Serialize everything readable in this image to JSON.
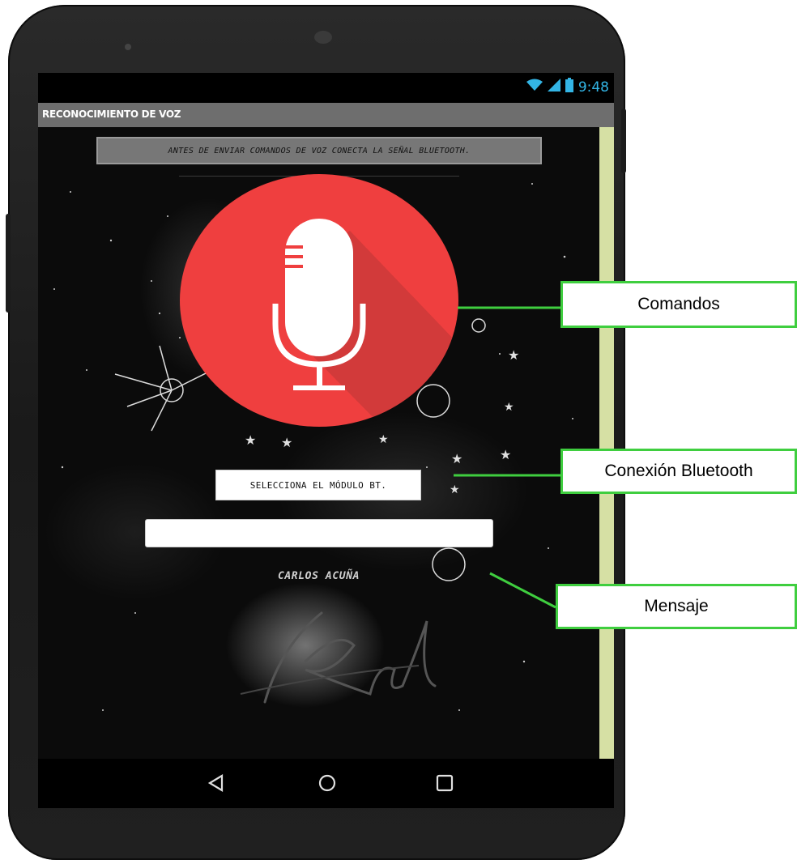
{
  "status_bar": {
    "time": "9:48",
    "icons": [
      "wifi-icon",
      "signal-icon",
      "battery-icon"
    ],
    "time_color": "#33b5e5"
  },
  "app": {
    "title": "RECONOCIMIENTO DE VOZ",
    "warning_text": "ANTES DE ENVIAR COMANDOS DE VOZ CONECTA LA SEÑAL BLUETOOTH.",
    "mic_button_icon": "microphone-icon",
    "mic_button_color": "#ef3f3f",
    "bluetooth_button_label": "SELECCIONA EL MÓDULO BT.",
    "message_value": "",
    "author": "CARLOS ACUÑA",
    "scrollbar_color": "#d6e0a4"
  },
  "nav_bar": {
    "icons": [
      "back-icon",
      "home-icon",
      "recents-icon"
    ]
  },
  "callouts": {
    "commands": "Comandos",
    "bluetooth": "Conexión Bluetooth",
    "message": "Mensaje",
    "color": "#3fce3f"
  }
}
